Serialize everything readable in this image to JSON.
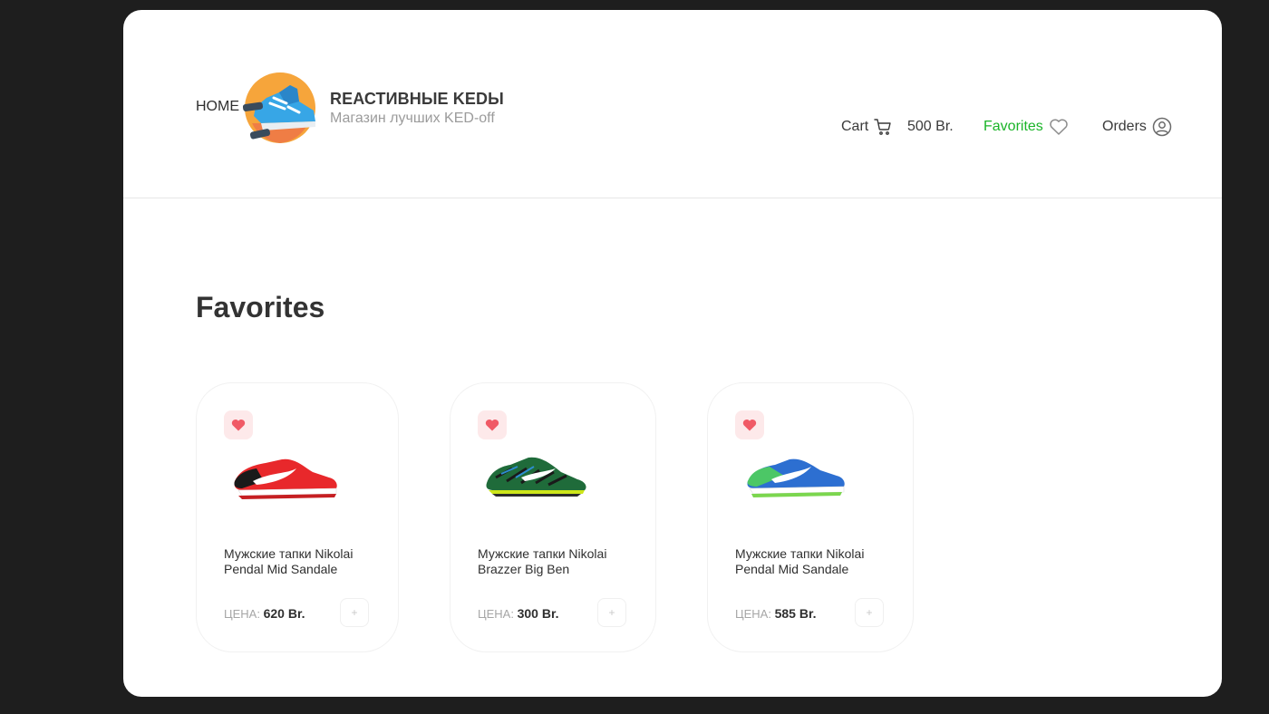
{
  "header": {
    "home_label": "HOME",
    "brand_title": "REАСТИВНЫЕ KEDЫ",
    "brand_subtitle": "Магазин лучших KED-off"
  },
  "nav": {
    "cart_label": "Cart",
    "cart_total": "500 Br.",
    "favorites_label": "Favorites",
    "orders_label": "Orders"
  },
  "page": {
    "title": "Favorites"
  },
  "colors": {
    "accent": "#1ab428",
    "favorite_bg": "#fde9ea",
    "heart": "#f05a66"
  },
  "products": [
    {
      "name": "Мужские тапки Nikolai Pendal Mid Sandale",
      "price_label": "ЦЕНА:",
      "price": "620 Br.",
      "icon": "heart-icon",
      "add_icon": "plus-icon"
    },
    {
      "name": "Мужские тапки Nikolai Brazzer Big Ben",
      "price_label": "ЦЕНА:",
      "price": "300 Br.",
      "icon": "heart-icon",
      "add_icon": "plus-icon"
    },
    {
      "name": "Мужские тапки Nikolai Pendal Mid Sandale",
      "price_label": "ЦЕНА:",
      "price": "585 Br.",
      "icon": "heart-icon",
      "add_icon": "plus-icon"
    }
  ]
}
